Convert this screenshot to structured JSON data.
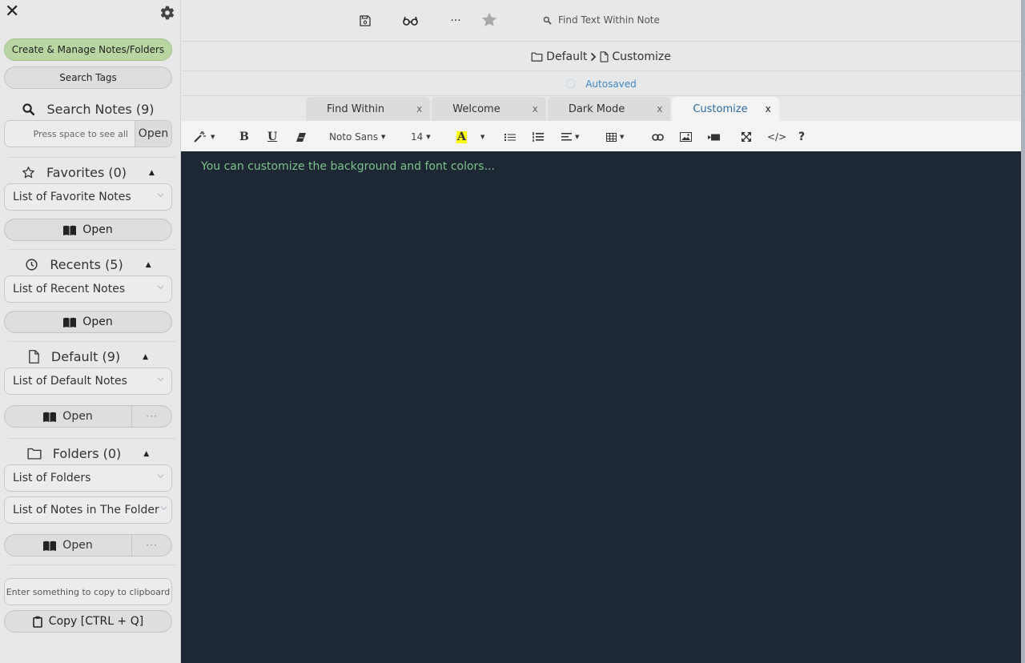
{
  "sidebar": {
    "close_icon": "close-icon",
    "settings_icon": "gear-icon",
    "create_manage_label": "Create & Manage Notes/Folders",
    "search_tags_label": "Search Tags",
    "search_notes": {
      "title": "Search Notes (9)",
      "placeholder": "Press space to see all",
      "open_label": "Open"
    },
    "favorites": {
      "title": "Favorites (0)",
      "select_value": "List of Favorite Notes",
      "open_label": "Open"
    },
    "recents": {
      "title": "Recents (5)",
      "select_value": "List of Recent Notes",
      "open_label": "Open"
    },
    "default": {
      "title": "Default (9)",
      "select_value": "List of Default Notes",
      "open_label": "Open",
      "more_label": "···"
    },
    "folders": {
      "title": "Folders (0)",
      "folder_select_value": "List of Folders",
      "notes_select_value": "List of Notes in The Folder",
      "open_label": "Open",
      "more_label": "···"
    },
    "clipboard": {
      "placeholder": "Enter something to copy to clipboard",
      "copy_label": "Copy [CTRL + Q]"
    }
  },
  "topbar": {
    "more_label": "···",
    "find_placeholder": "Find Text Within Note"
  },
  "breadcrumb": {
    "folder": "Default",
    "separator": ">",
    "note": "Customize"
  },
  "status": {
    "text": "Autosaved",
    "color": "#3a87c8"
  },
  "tabs": [
    {
      "label": "Find Within",
      "close": "x",
      "active": false
    },
    {
      "label": "Welcome",
      "close": "x",
      "active": false
    },
    {
      "label": "Dark Mode",
      "close": "x",
      "active": false
    },
    {
      "label": "Customize",
      "close": "x",
      "active": true
    }
  ],
  "toolbar": {
    "font_family": "Noto Sans",
    "font_size": "14",
    "highlight_color": "#ffff00",
    "codeview_label": "</>",
    "help_label": "?"
  },
  "editor": {
    "content": "You can customize the background and font colors...",
    "background_color": "#1d2834",
    "text_color": "#7dc28c"
  }
}
